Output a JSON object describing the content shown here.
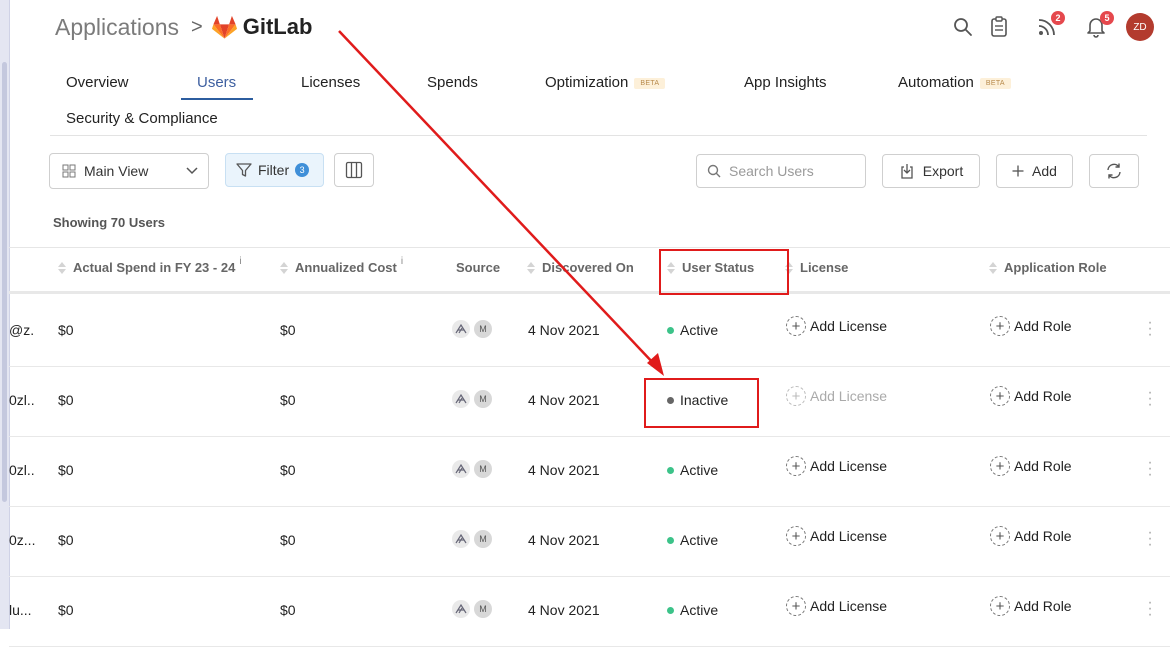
{
  "breadcrumb": {
    "root": "Applications",
    "separator": ">",
    "app_name": "GitLab"
  },
  "header": {
    "icons": [
      "search-icon",
      "clipboard-icon",
      "feed-icon",
      "bell-icon"
    ],
    "feed_badge": "2",
    "bell_badge": "5",
    "avatar_initials": "ZD"
  },
  "tabs": [
    {
      "label": "Overview"
    },
    {
      "label": "Users",
      "active": true
    },
    {
      "label": "Licenses"
    },
    {
      "label": "Spends"
    },
    {
      "label": "Optimization",
      "badge": "BETA"
    },
    {
      "label": "App Insights"
    },
    {
      "label": "Automation",
      "badge": "BETA"
    },
    {
      "label": "Security & Compliance"
    }
  ],
  "toolbar": {
    "view_label": "Main View",
    "filter_label": "Filter",
    "filter_count": "3",
    "search_placeholder": "Search Users",
    "export_label": "Export",
    "add_label": "Add"
  },
  "summary": "Showing 70 Users",
  "table": {
    "columns": [
      "Actual Spend in FY 23 - 24",
      "Annualized Cost",
      "Source",
      "Discovered On",
      "User Status",
      "License",
      "Application Role"
    ],
    "info_marker": "i",
    "source_badge": "M",
    "rows": [
      {
        "email": "@z...",
        "spend": "$0",
        "cost": "$0",
        "discovered": "4 Nov 2021",
        "status": "Active",
        "license": "Add License",
        "license_enabled": true,
        "role": "Add Role"
      },
      {
        "email": "0zl...",
        "spend": "$0",
        "cost": "$0",
        "discovered": "4 Nov 2021",
        "status": "Inactive",
        "license": "Add License",
        "license_enabled": false,
        "role": "Add Role"
      },
      {
        "email": "0zl...",
        "spend": "$0",
        "cost": "$0",
        "discovered": "4 Nov 2021",
        "status": "Active",
        "license": "Add License",
        "license_enabled": true,
        "role": "Add Role"
      },
      {
        "email": "0z...",
        "spend": "$0",
        "cost": "$0",
        "discovered": "4 Nov 2021",
        "status": "Active",
        "license": "Add License",
        "license_enabled": true,
        "role": "Add Role"
      },
      {
        "email": "lu...",
        "spend": "$0",
        "cost": "$0",
        "discovered": "4 Nov 2021",
        "status": "Active",
        "license": "Add License",
        "license_enabled": true,
        "role": "Add Role"
      }
    ]
  },
  "colors": {
    "active_dot": "#3cc389",
    "inactive_dot": "#666666",
    "annotation": "#e01b1b",
    "accent": "#2c5d9f"
  }
}
